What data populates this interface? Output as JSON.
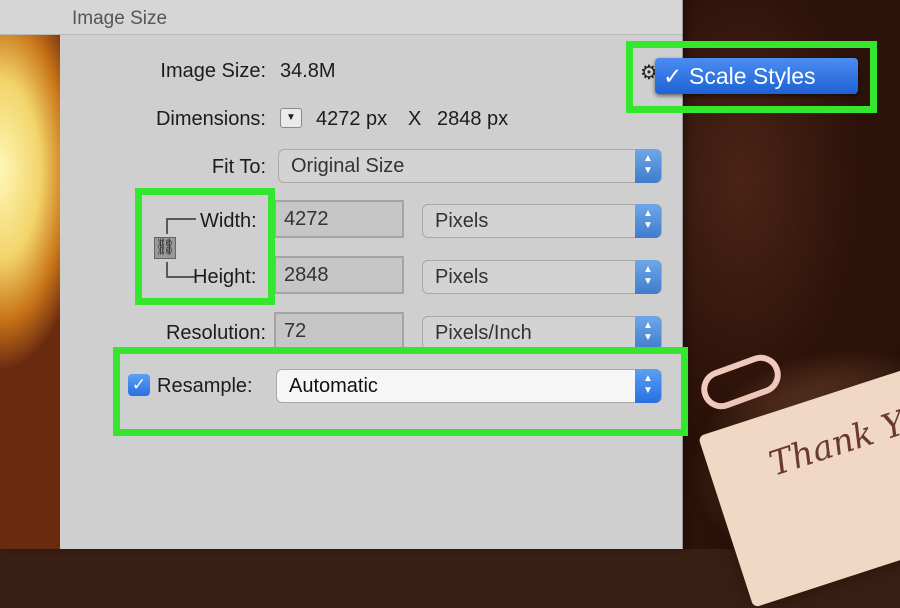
{
  "dialog": {
    "title": "Image Size",
    "image_size": {
      "label": "Image Size:",
      "value": "34.8M"
    },
    "dimensions": {
      "label": "Dimensions:",
      "width_px": "4272 px",
      "x": "X",
      "height_px": "2848 px"
    },
    "fit_to": {
      "label": "Fit To:",
      "value": "Original Size"
    },
    "width": {
      "label": "Width:",
      "value": "4272",
      "unit": "Pixels"
    },
    "height": {
      "label": "Height:",
      "value": "2848",
      "unit": "Pixels"
    },
    "resolution": {
      "label": "Resolution:",
      "value": "72",
      "unit": "Pixels/Inch"
    },
    "resample": {
      "label": "Resample:",
      "checked": true,
      "value": "Automatic"
    }
  },
  "scale_styles_menu": {
    "check": "✓",
    "label": "Scale Styles"
  },
  "icons": {
    "gear": "gear-icon",
    "chain": "chain-link-icon",
    "disclosure": "disclosure-triangle-icon",
    "stepper": "up-down-stepper-icon",
    "checkmark": "checkmark-icon"
  },
  "colors": {
    "highlight": "#34e62e",
    "accent_blue": "#2a6fe0",
    "dialog_bg": "#cfcfcf"
  },
  "background_card": {
    "text": "Thank Y"
  }
}
